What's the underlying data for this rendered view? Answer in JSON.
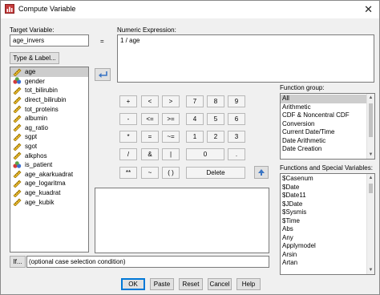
{
  "window": {
    "title": "Compute Variable",
    "close_glyph": "✕"
  },
  "target": {
    "label": "Target Variable:",
    "value": "age_invers",
    "type_label_button": "Type & Label...",
    "equals": "="
  },
  "expression": {
    "label": "Numeric Expression:",
    "value": "1 / age"
  },
  "variables": [
    {
      "name": "age",
      "icon": "ruler-icon",
      "selected": true
    },
    {
      "name": "gender",
      "icon": "nominal-icon"
    },
    {
      "name": "tot_bilirubin",
      "icon": "ruler-icon"
    },
    {
      "name": "direct_bilirubin",
      "icon": "ruler-icon"
    },
    {
      "name": "tot_proteins",
      "icon": "ruler-icon"
    },
    {
      "name": "albumin",
      "icon": "ruler-icon"
    },
    {
      "name": "ag_ratio",
      "icon": "ruler-icon"
    },
    {
      "name": "sgpt",
      "icon": "ruler-icon"
    },
    {
      "name": "sgot",
      "icon": "ruler-icon"
    },
    {
      "name": "alkphos",
      "icon": "ruler-icon"
    },
    {
      "name": "is_patient",
      "icon": "nominal-icon"
    },
    {
      "name": "age_akarkuadrat",
      "icon": "ruler-icon"
    },
    {
      "name": "age_logaritma",
      "icon": "ruler-icon"
    },
    {
      "name": "age_kuadrat",
      "icon": "ruler-icon"
    },
    {
      "name": "age_kubik",
      "icon": "ruler-icon"
    }
  ],
  "keypad": {
    "operators": [
      [
        "+",
        "<",
        ">"
      ],
      [
        "-",
        "<=",
        ">="
      ],
      [
        "*",
        "=",
        "~="
      ],
      [
        "/",
        "&",
        "|"
      ],
      [
        "**",
        "~",
        "( )"
      ]
    ],
    "digits": [
      [
        "7",
        "8",
        "9"
      ],
      [
        "4",
        "5",
        "6"
      ],
      [
        "1",
        "2",
        "3"
      ]
    ],
    "zero": "0",
    ".": ".",
    "delete": "Delete"
  },
  "function_group": {
    "label": "Function group:",
    "items": [
      "All",
      "Arithmetic",
      "CDF & Noncentral CDF",
      "Conversion",
      "Current Date/Time",
      "Date Arithmetic",
      "Date Creation"
    ],
    "selected": 0
  },
  "functions": {
    "label": "Functions and Special Variables:",
    "items": [
      "$Casenum",
      "$Date",
      "$Date11",
      "$JDate",
      "$Sysmis",
      "$Time",
      "Abs",
      "Any",
      "Applymodel",
      "Arsin",
      "Artan"
    ]
  },
  "if_button": "If...",
  "case_condition": "(optional case selection condition)",
  "buttons": {
    "ok": "OK",
    "paste": "Paste",
    "reset": "Reset",
    "cancel": "Cancel",
    "help": "Help"
  },
  "colors": {
    "accent": "#0078d7",
    "move_arrow": "#3a75c4",
    "selection": "#cdcdcd"
  }
}
